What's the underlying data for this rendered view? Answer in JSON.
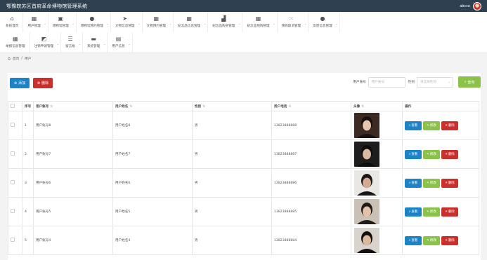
{
  "app_title": "鄂豫皖苏区首府革命博物馆管理系统",
  "user": {
    "name": "abcce"
  },
  "nav": {
    "row1": [
      {
        "label": "系统首页",
        "icon": "home-icon",
        "glyph": "⌂"
      },
      {
        "label": "用户管理",
        "icon": "grid-icon",
        "glyph": "▦"
      },
      {
        "label": "博物馆管理",
        "icon": "building-icon",
        "glyph": "▣"
      },
      {
        "label": "博物馆预约管理",
        "icon": "person-icon",
        "glyph": "●"
      },
      {
        "label": "文物信息管理",
        "icon": "send-icon",
        "glyph": "➤"
      },
      {
        "label": "文物预约管理",
        "icon": "grid-icon",
        "glyph": "▦"
      },
      {
        "label": "纪念品信息管理",
        "icon": "grid-icon",
        "glyph": "▦"
      },
      {
        "label": "纪念品购买管理",
        "icon": "factory-icon",
        "glyph": "▟"
      },
      {
        "label": "纪念品预购管理",
        "icon": "grid-icon",
        "glyph": "▦"
      },
      {
        "label": "预购取消管理",
        "icon": "apps-icon",
        "glyph": "⁙"
      },
      {
        "label": "反馈信息管理",
        "icon": "pin-icon",
        "glyph": "●"
      }
    ],
    "row2": [
      {
        "label": "举报信息管理",
        "icon": "grid-icon",
        "glyph": "▦"
      },
      {
        "label": "注销申请管理",
        "icon": "chart-icon",
        "glyph": "◩"
      },
      {
        "label": "留言板",
        "icon": "sliders-icon",
        "glyph": "☰"
      },
      {
        "label": "系统管理",
        "icon": "monitor-icon",
        "glyph": "▬"
      },
      {
        "label": "用户信息",
        "icon": "calendar-icon",
        "glyph": "▤"
      }
    ]
  },
  "breadcrumb": {
    "home": "首页",
    "separator": "/",
    "current": "用户"
  },
  "toolbar": {
    "add_label": "添加",
    "delete_label": "删除"
  },
  "search": {
    "account_label": "用户账号",
    "account_placeholder": "用户账号",
    "gender_label": "性别",
    "gender_placeholder": "请选择性别",
    "button_label": "查询"
  },
  "table": {
    "headers": [
      "序号",
      "用户账号",
      "用户姓名",
      "性别",
      "用户电话",
      "头像",
      "操作"
    ],
    "rows": [
      {
        "index": "1",
        "account": "用户账号8",
        "name": "用户姓名8",
        "gender": "男",
        "phone": "13823888888"
      },
      {
        "index": "2",
        "account": "用户账号7",
        "name": "用户姓名7",
        "gender": "男",
        "phone": "13823888887"
      },
      {
        "index": "3",
        "account": "用户账号6",
        "name": "用户姓名6",
        "gender": "男",
        "phone": "13823888886"
      },
      {
        "index": "4",
        "account": "用户账号5",
        "name": "用户姓名5",
        "gender": "男",
        "phone": "13823888885"
      },
      {
        "index": "5",
        "account": "用户账号4",
        "name": "用户姓名4",
        "gender": "男",
        "phone": "13823888884"
      }
    ],
    "op_labels": {
      "view": "查看",
      "edit": "修改",
      "delete": "删除"
    }
  },
  "colors": {
    "topbar": "#2f4050",
    "primary": "#1c84c6",
    "success": "#8bc34a",
    "danger": "#c9302c"
  }
}
